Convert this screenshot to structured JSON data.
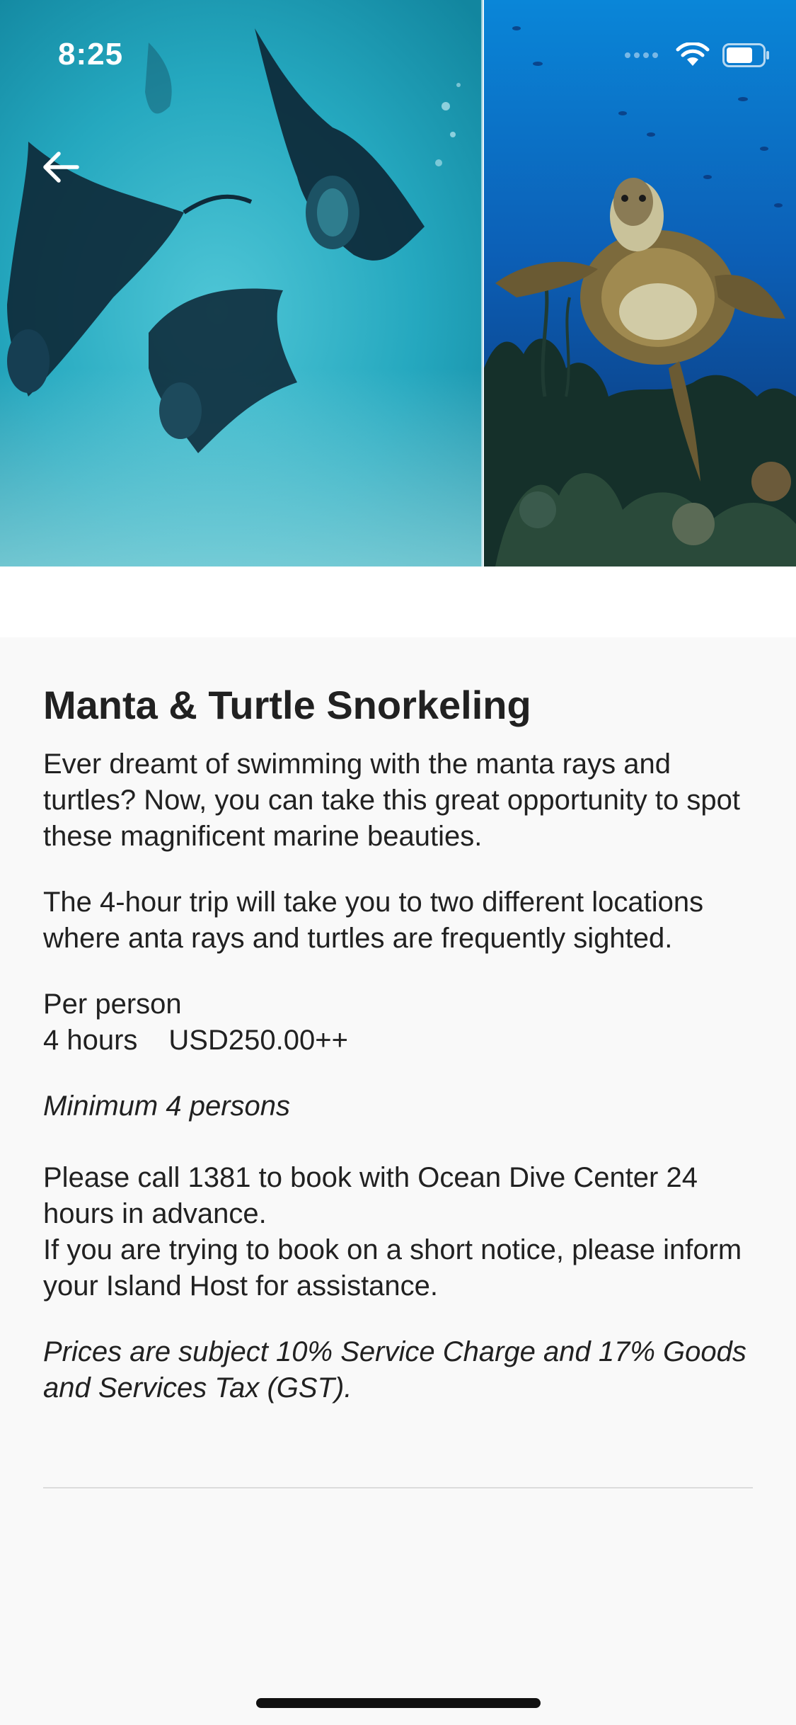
{
  "status_bar": {
    "time": "8:25"
  },
  "hero": {
    "left_scene": "manta rays",
    "right_scene": "sea turtle"
  },
  "navigation": {
    "back_icon": "arrow-left-icon"
  },
  "activity": {
    "title": "Manta & Turtle Snorkeling",
    "description_1": "Ever dreamt of swimming with the manta rays and turtles? Now, you can take this great opportunity to spot these magnificent marine beauties.",
    "description_2": "The 4-hour trip will take you to two different locations where anta rays and turtles are frequently sighted.",
    "price_basis": "Per person",
    "duration": "4 hours",
    "price": "USD250.00++",
    "minimum": "Minimum 4 persons",
    "booking_1": "Please call 1381 to book with Ocean Dive Center 24 hours in advance.",
    "booking_2": "If you are trying to book on a short notice, please inform your Island Host for assistance.",
    "tax_note": "Prices are subject 10% Service Charge and 17% Goods and Services Tax (GST)."
  },
  "colors": {
    "text": "#212121",
    "background": "#f9f9f9",
    "divider": "#dcdcdc"
  }
}
